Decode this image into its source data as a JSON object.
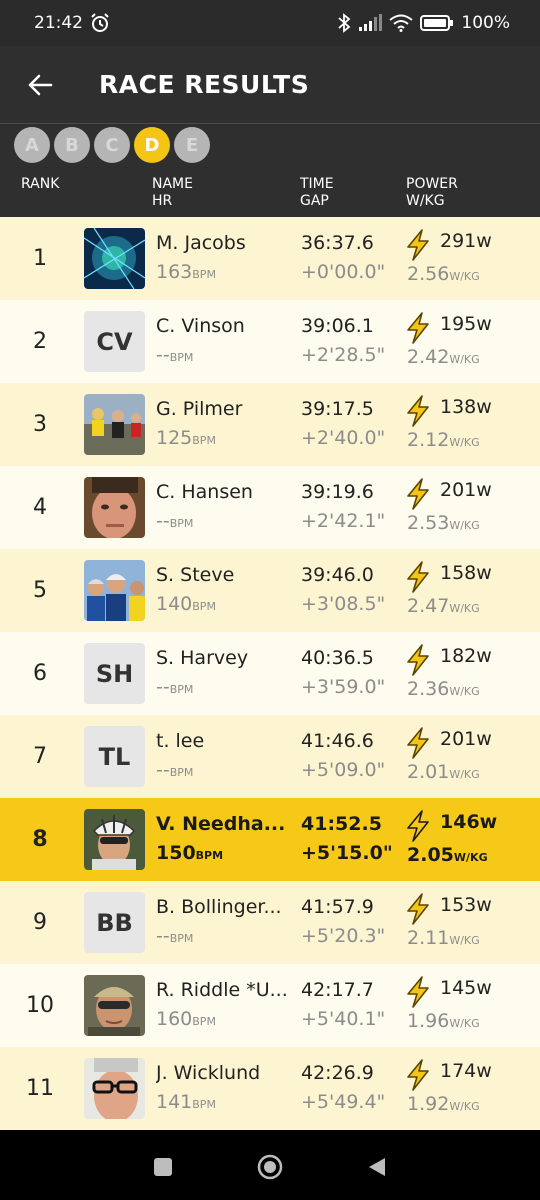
{
  "status": {
    "time": "21:42",
    "battery": "100%"
  },
  "header": {
    "title": "RACE RESULTS"
  },
  "categories": [
    {
      "label": "A",
      "active": false
    },
    {
      "label": "B",
      "active": false
    },
    {
      "label": "C",
      "active": false
    },
    {
      "label": "D",
      "active": true
    },
    {
      "label": "E",
      "active": false
    }
  ],
  "columns": {
    "rank": "RANK",
    "name": "NAME",
    "hr": "HR",
    "time": "TIME",
    "gap": "GAP",
    "power": "POWER",
    "wkg": "W/KG"
  },
  "units": {
    "bpm": "BPM",
    "wkg": "W/KG"
  },
  "colors": {
    "accent": "#f6c919",
    "header_bg": "#2f2f2f",
    "row_odd": "#fdf5d2",
    "row_even": "#fefcee"
  },
  "results": [
    {
      "rank": "1",
      "name": "M. Jacobs",
      "hr": "163",
      "time": "36:37.6",
      "gap": "+0'00.0\"",
      "watts": "291w",
      "wkg": "2.56",
      "avatar": "photo-abstract-blue"
    },
    {
      "rank": "2",
      "name": "C. Vinson",
      "hr": "--",
      "time": "39:06.1",
      "gap": "+2'28.5\"",
      "watts": "195w",
      "wkg": "2.42",
      "initials": "CV"
    },
    {
      "rank": "3",
      "name": "G. Pilmer",
      "hr": "125",
      "time": "39:17.5",
      "gap": "+2'40.0\"",
      "watts": "138w",
      "wkg": "2.12",
      "avatar": "photo-cyclists"
    },
    {
      "rank": "4",
      "name": "C. Hansen",
      "hr": "--",
      "time": "39:19.6",
      "gap": "+2'42.1\"",
      "watts": "201w",
      "wkg": "2.53",
      "avatar": "photo-face"
    },
    {
      "rank": "5",
      "name": "S. Steve",
      "hr": "140",
      "time": "39:46.0",
      "gap": "+3'08.5\"",
      "watts": "158w",
      "wkg": "2.47",
      "avatar": "photo-cyclists-group"
    },
    {
      "rank": "6",
      "name": "S. Harvey",
      "hr": "--",
      "time": "40:36.5",
      "gap": "+3'59.0\"",
      "watts": "182w",
      "wkg": "2.36",
      "initials": "SH"
    },
    {
      "rank": "7",
      "name": "t. lee",
      "hr": "--",
      "time": "41:46.6",
      "gap": "+5'09.0\"",
      "watts": "201w",
      "wkg": "2.01",
      "initials": "TL"
    },
    {
      "rank": "8",
      "name": "V. Needha...",
      "hr": "150",
      "time": "41:52.5",
      "gap": "+5'15.0\"",
      "watts": "146w",
      "wkg": "2.05",
      "avatar": "photo-helmet",
      "me": true
    },
    {
      "rank": "9",
      "name": "B. Bollinger...",
      "hr": "--",
      "time": "41:57.9",
      "gap": "+5'20.3\"",
      "watts": "153w",
      "wkg": "2.11",
      "initials": "BB"
    },
    {
      "rank": "10",
      "name": "R. Riddle *U...",
      "hr": "160",
      "time": "42:17.7",
      "gap": "+5'40.1\"",
      "watts": "145w",
      "wkg": "1.96",
      "avatar": "photo-sunglasses"
    },
    {
      "rank": "11",
      "name": "J. Wicklund",
      "hr": "141",
      "time": "42:26.9",
      "gap": "+5'49.4\"",
      "watts": "174w",
      "wkg": "1.92",
      "avatar": "photo-glasses-face"
    }
  ]
}
